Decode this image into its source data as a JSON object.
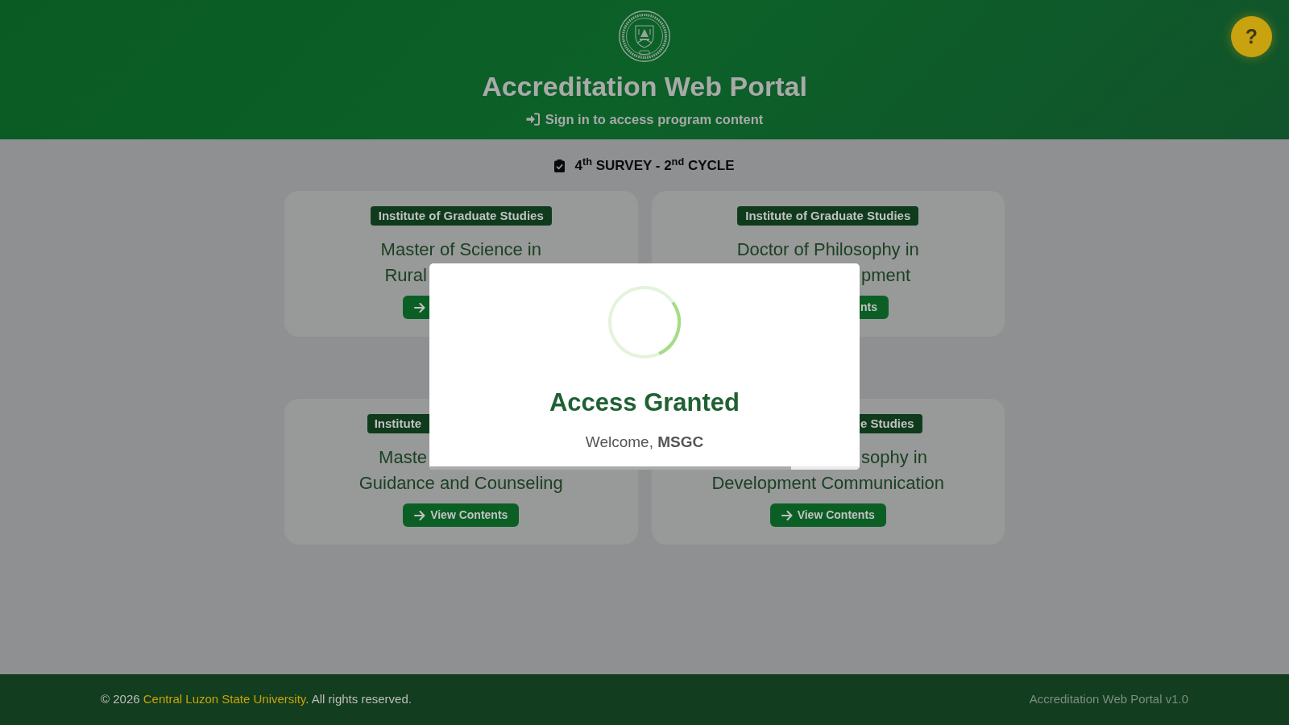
{
  "header": {
    "title": "Accreditation Web Portal",
    "sign_in_link": "Sign in to access program content"
  },
  "help_button": {
    "label": "?"
  },
  "survey_heading": "4$^{th}$ SURVEY - 2$^{nd}$ CYCLE",
  "programs": [
    {
      "institute": {
        "text": "Institute of Graduate Studies",
        "cut_by_dialog": false
      },
      "title_lines": [
        {
          "text": "Master of Science in",
          "cut_by_dialog": false
        },
        {
          "text": "Rural",
          "cut_by_dialog": true
        }
      ],
      "button": {
        "cut_by_dialog": true
      }
    },
    {
      "institute": {
        "text": "Institute of Graduate Studies",
        "cut_by_dialog": false
      },
      "title_lines": [
        {
          "text": "Doctor of Philosophy in",
          "cut_by_dialog": false
        },
        {
          "text": "pment",
          "cut_by_dialog": true
        }
      ],
      "button": {
        "label": "nts",
        "cut_by_dialog": true
      }
    },
    {
      "institute": {
        "text": "Institute",
        "cut_by_dialog": true
      },
      "title_lines": [
        {
          "text": "Maste",
          "cut_by_dialog": true
        },
        {
          "text": "Guidance and Counseling",
          "cut_by_dialog": false
        }
      ],
      "button": {
        "label": "View Contents",
        "cut_by_dialog": false
      }
    },
    {
      "institute": {
        "text": "e Studies",
        "cut_by_dialog": true
      },
      "title_lines": [
        {
          "text": "sophy in",
          "cut_by_dialog": true
        },
        {
          "text": "Development Communication",
          "cut_by_dialog": false
        }
      ],
      "button": {
        "label": "View Contents",
        "cut_by_dialog": false
      }
    }
  ],
  "dialog": {
    "title": "Access Granted",
    "message": "Welcome, **MSGC**",
    "timer": {
      "level": 0.84
    }
  },
  "footer": {
    "copyright": "© 2026",
    "link": "Central Luzon State University",
    "rights": ". All rights reserved.",
    "version": "Accreditation Web Portal v1.0"
  }
}
